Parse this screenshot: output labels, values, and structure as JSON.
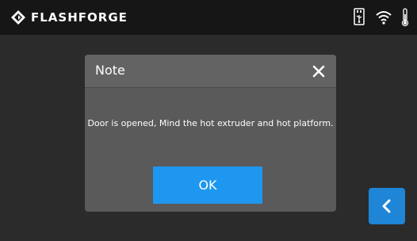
{
  "header": {
    "brand": "FLASHFORGE",
    "icons": [
      "usb-icon",
      "wifi-icon",
      "thermometer-icon"
    ]
  },
  "dialog": {
    "title": "Note",
    "message": "Door is opened, Mind the hot extruder and hot platform.",
    "ok_label": "OK"
  },
  "nav": {
    "back_icon": "chevron-left-icon"
  },
  "colors": {
    "accent": "#1e97f0",
    "back_button": "#1f85d6",
    "dialog_bg": "#5a5a5a",
    "topbar_bg": "#161616"
  }
}
